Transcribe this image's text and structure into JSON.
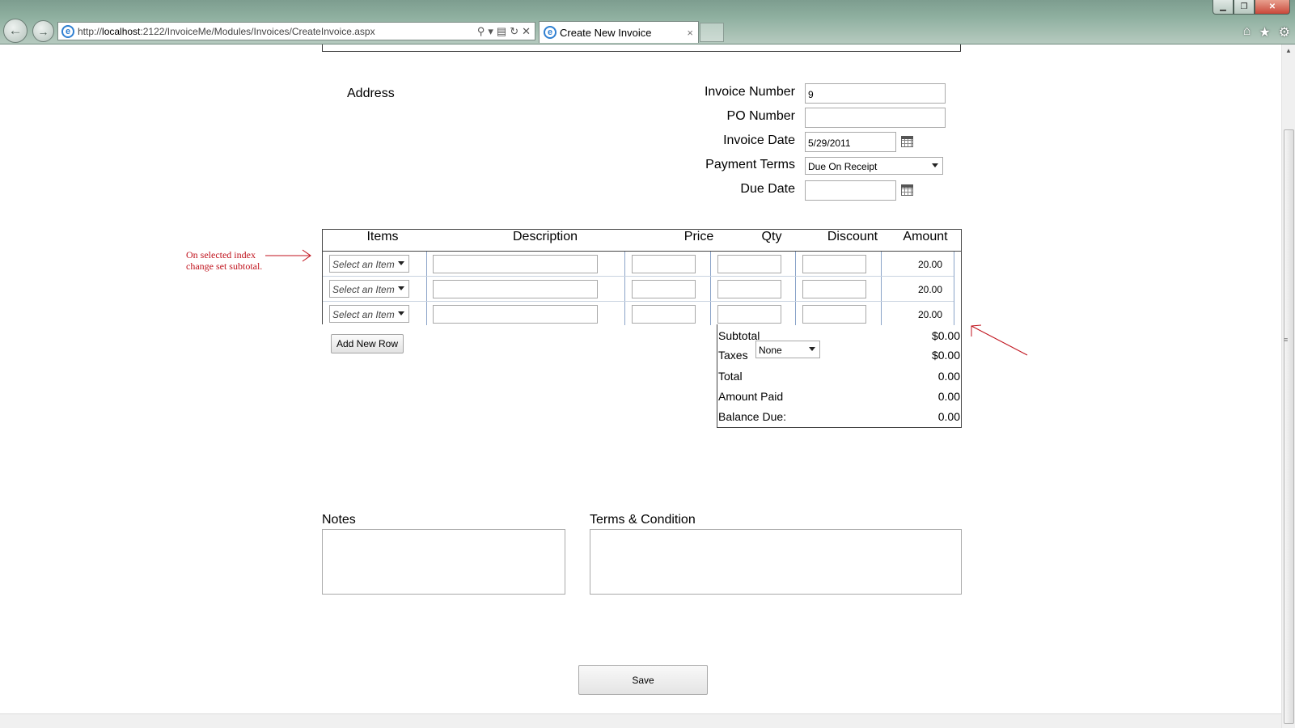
{
  "browser": {
    "url_prefix": "http://",
    "url_host": "localhost",
    "url_rest": ":2122/InvoiceMe/Modules/Invoices/CreateInvoice.aspx",
    "tab_title": "Create New Invoice",
    "close_glyph": "×",
    "min_glyph": "▁",
    "restore_glyph": "❐",
    "window_close_glyph": "✕",
    "back_glyph": "←",
    "forward_glyph": "→",
    "home_glyph": "⌂",
    "favorites_glyph": "★",
    "tools_glyph": "⚙",
    "search_glyph": "⚲",
    "dropdown_glyph": "▾",
    "refresh_glyph": "↻",
    "stop_glyph": "✕",
    "compat_glyph": "▤",
    "ie_glyph": "e"
  },
  "header": {
    "address_label": "Address"
  },
  "form": {
    "invoice_number_label": "Invoice Number",
    "invoice_number_value": "9",
    "po_number_label": "PO Number",
    "po_number_value": "",
    "invoice_date_label": "Invoice Date",
    "invoice_date_value": "5/29/2011",
    "payment_terms_label": "Payment Terms",
    "payment_terms_value": "Due On Receipt",
    "due_date_label": "Due Date",
    "due_date_value": ""
  },
  "table": {
    "headers": {
      "items": "Items",
      "description": "Description",
      "price": "Price",
      "qty": "Qty",
      "discount": "Discount",
      "amount": "Amount"
    },
    "rows": [
      {
        "item": "Select an Item",
        "amount": "20.00"
      },
      {
        "item": "Select an Item",
        "amount": "20.00"
      },
      {
        "item": "Select an Item",
        "amount": "20.00"
      }
    ],
    "add_row_label": "Add New Row"
  },
  "totals": {
    "subtotal_label": "Subtotal",
    "subtotal_value": "$0.00",
    "taxes_label": "Taxes",
    "taxes_option": "None",
    "taxes_value": "$0.00",
    "total_label": "Total",
    "total_value": "0.00",
    "amount_paid_label": "Amount Paid",
    "amount_paid_value": "0.00",
    "balance_due_label": "Balance Due:",
    "balance_due_value": "0.00"
  },
  "annotation": {
    "line1": "On selected index",
    "line2": "change set subtotal.",
    "color": "#c0121c"
  },
  "footer": {
    "notes_label": "Notes",
    "terms_label": "Terms & Condition",
    "save_label": "Save"
  }
}
